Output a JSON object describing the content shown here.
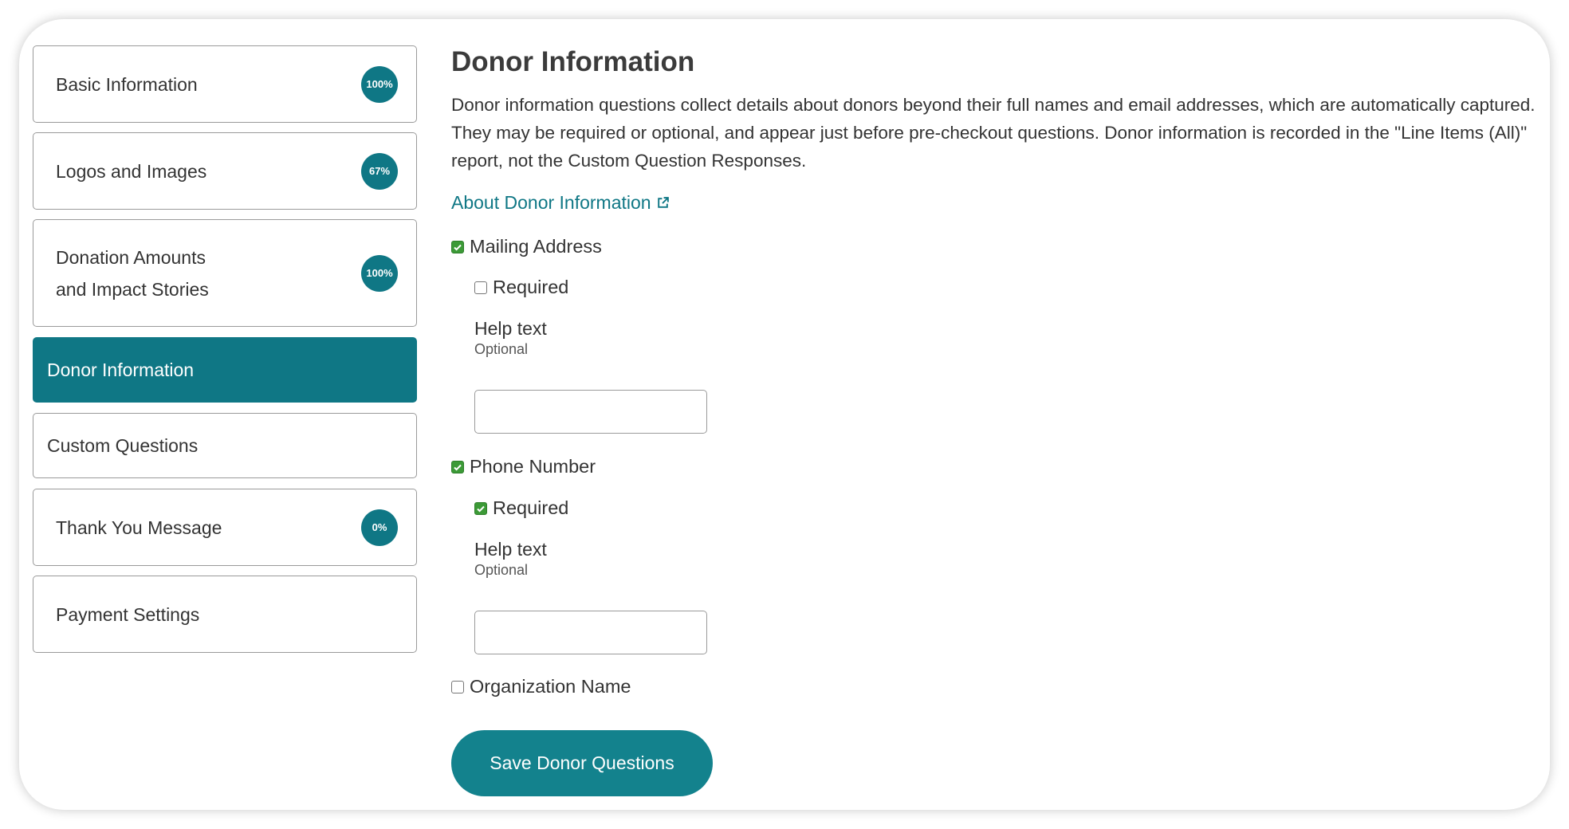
{
  "sidebar": {
    "items": [
      {
        "label": "Basic Information",
        "badge": "100%"
      },
      {
        "label": "Logos and Images",
        "badge": "67%"
      },
      {
        "label": "Donation Amounts and Impact Stories",
        "label_line1": "Donation Amounts",
        "label_line2": "and Impact Stories",
        "badge": "100%"
      },
      {
        "label": "Donor Information",
        "active": true
      },
      {
        "label": "Custom Questions"
      },
      {
        "label": "Thank You Message",
        "badge": "0%"
      },
      {
        "label": "Payment Settings"
      }
    ]
  },
  "main": {
    "title": "Donor Information",
    "description": "Donor information questions collect details about donors beyond their full names and email addresses, which are automatically captured. They may be required or optional, and appear just before pre-checkout questions. Donor information is recorded in the \"Line Items (All)\" report, not the Custom Question Responses.",
    "about_link": "About Donor Information",
    "fields": [
      {
        "label": "Mailing Address",
        "enabled": true,
        "required_label": "Required",
        "required": false,
        "help_label": "Help text",
        "help_hint": "Optional",
        "help_value": ""
      },
      {
        "label": "Phone Number",
        "enabled": true,
        "required_label": "Required",
        "required": true,
        "help_label": "Help text",
        "help_hint": "Optional",
        "help_value": ""
      },
      {
        "label": "Organization Name",
        "enabled": false
      }
    ],
    "save_label": "Save Donor Questions"
  },
  "colors": {
    "accent": "#0f7785",
    "checkbox_checked": "#3c9a37"
  },
  "icons": {
    "about_link_icon": "external-link-icon",
    "checked_mark": "checkmark-icon"
  }
}
